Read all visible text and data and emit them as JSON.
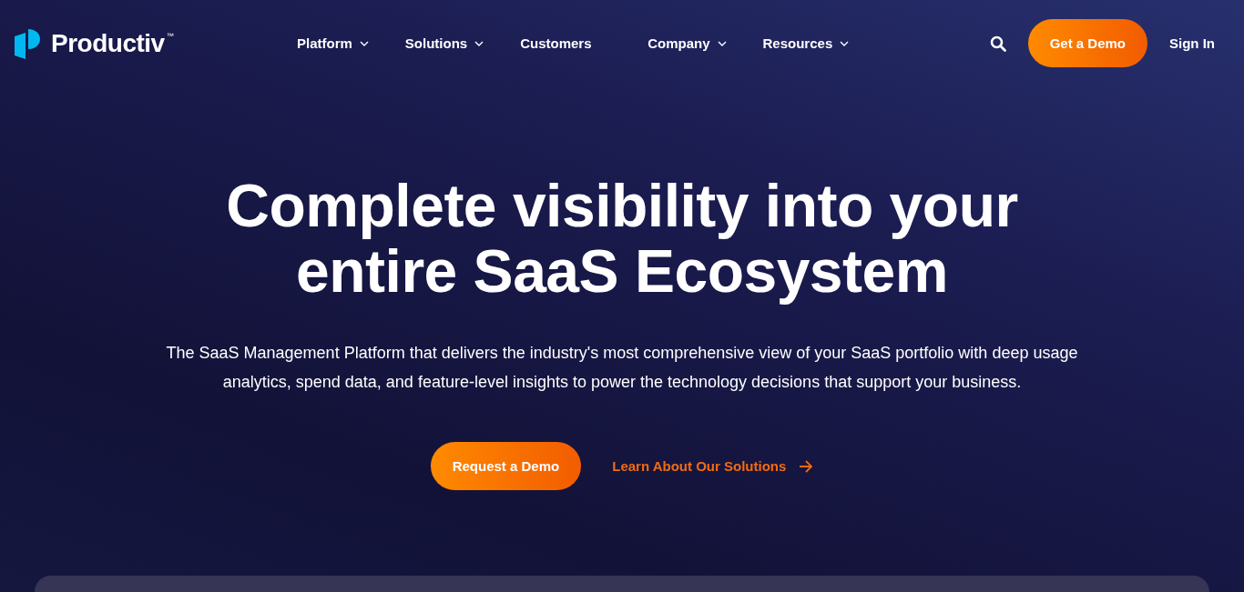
{
  "logo": {
    "name": "Productiv",
    "mark": "™"
  },
  "nav": [
    {
      "label": "Platform",
      "dropdown": true
    },
    {
      "label": "Solutions",
      "dropdown": true
    },
    {
      "label": "Customers",
      "dropdown": false
    },
    {
      "label": "Company",
      "dropdown": true
    },
    {
      "label": "Resources",
      "dropdown": true
    }
  ],
  "header_actions": {
    "cta": "Get a Demo",
    "sign_in": "Sign In"
  },
  "hero": {
    "title_lines": [
      "Complete visibility into your",
      "entire SaaS Ecosystem"
    ],
    "subtitle": "The SaaS Management Platform that delivers the industry's most comprehensive view of your SaaS portfolio with deep usage analytics, spend data, and feature-level insights to power the technology decisions that support your business.",
    "primary_button": "Request a Demo",
    "secondary_link": "Learn About Our Solutions"
  }
}
